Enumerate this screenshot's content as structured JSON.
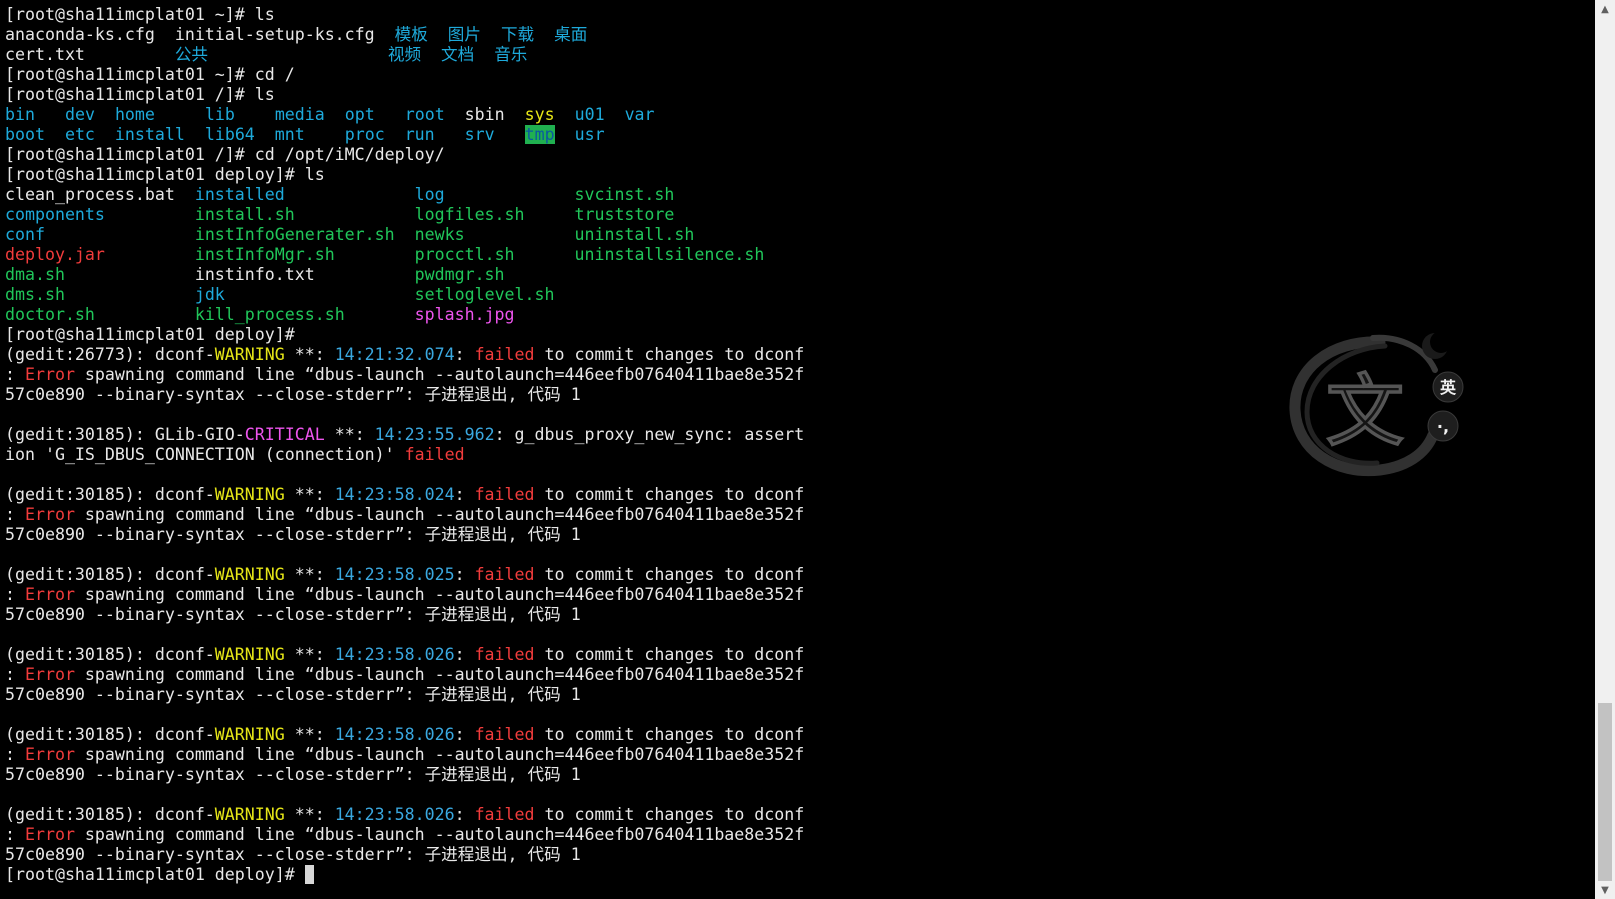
{
  "colors": {
    "background": "#000000",
    "default_text": "#e8e8e8",
    "directory": "#1eaadb",
    "executable": "#20c65a",
    "archive": "#f23c3c",
    "warning": "#e6e617",
    "critical": "#ee55ee",
    "timestamp": "#3aa8e0",
    "tmp_highlight_bg": "#20b050"
  },
  "lines": [
    [
      {
        "t": "[root@sha11imcplat01 ~]# ls",
        "c": "white"
      }
    ],
    [
      {
        "t": "anaconda-ks.cfg  initial-setup-ks.cfg  ",
        "c": "white"
      },
      {
        "t": "模板",
        "c": "blue"
      },
      {
        "t": "  ",
        "c": "white"
      },
      {
        "t": "图片",
        "c": "blue"
      },
      {
        "t": "  ",
        "c": "white"
      },
      {
        "t": "下载",
        "c": "blue"
      },
      {
        "t": "  ",
        "c": "white"
      },
      {
        "t": "桌面",
        "c": "blue"
      }
    ],
    [
      {
        "t": "cert.txt         ",
        "c": "white"
      },
      {
        "t": "公共",
        "c": "blue"
      },
      {
        "t": "                  ",
        "c": "white"
      },
      {
        "t": "视频",
        "c": "blue"
      },
      {
        "t": "  ",
        "c": "white"
      },
      {
        "t": "文档",
        "c": "blue"
      },
      {
        "t": "  ",
        "c": "white"
      },
      {
        "t": "音乐",
        "c": "blue"
      }
    ],
    [
      {
        "t": "[root@sha11imcplat01 ~]# cd /",
        "c": "white"
      }
    ],
    [
      {
        "t": "[root@sha11imcplat01 /]# ls",
        "c": "white"
      }
    ],
    [
      {
        "t": "bin",
        "c": "blue"
      },
      {
        "t": "   ",
        "c": "white"
      },
      {
        "t": "dev",
        "c": "blue"
      },
      {
        "t": "  ",
        "c": "white"
      },
      {
        "t": "home",
        "c": "blue"
      },
      {
        "t": "     ",
        "c": "white"
      },
      {
        "t": "lib",
        "c": "blue"
      },
      {
        "t": "    ",
        "c": "white"
      },
      {
        "t": "media",
        "c": "blue"
      },
      {
        "t": "  ",
        "c": "white"
      },
      {
        "t": "opt",
        "c": "blue"
      },
      {
        "t": "   ",
        "c": "white"
      },
      {
        "t": "root",
        "c": "blue"
      },
      {
        "t": "  ",
        "c": "white"
      },
      {
        "t": "sbin",
        "c": "white"
      },
      {
        "t": "  ",
        "c": "white"
      },
      {
        "t": "sys",
        "c": "yellow"
      },
      {
        "t": "  ",
        "c": "white"
      },
      {
        "t": "u01",
        "c": "blue"
      },
      {
        "t": "  ",
        "c": "white"
      },
      {
        "t": "var",
        "c": "blue"
      }
    ],
    [
      {
        "t": "boot",
        "c": "blue"
      },
      {
        "t": "  ",
        "c": "white"
      },
      {
        "t": "etc",
        "c": "blue"
      },
      {
        "t": "  ",
        "c": "white"
      },
      {
        "t": "install",
        "c": "blue"
      },
      {
        "t": "  ",
        "c": "white"
      },
      {
        "t": "lib64",
        "c": "blue"
      },
      {
        "t": "  ",
        "c": "white"
      },
      {
        "t": "mnt",
        "c": "blue"
      },
      {
        "t": "    ",
        "c": "white"
      },
      {
        "t": "proc",
        "c": "blue"
      },
      {
        "t": "  ",
        "c": "white"
      },
      {
        "t": "run",
        "c": "blue"
      },
      {
        "t": "   ",
        "c": "white"
      },
      {
        "t": "srv",
        "c": "blue"
      },
      {
        "t": "   ",
        "c": "white"
      },
      {
        "t": "tmp",
        "c": "hl"
      },
      {
        "t": "  ",
        "c": "white"
      },
      {
        "t": "usr",
        "c": "blue"
      }
    ],
    [
      {
        "t": "[root@sha11imcplat01 /]# cd /opt/iMC/deploy/",
        "c": "white"
      }
    ],
    [
      {
        "t": "[root@sha11imcplat01 deploy]# ls",
        "c": "white"
      }
    ],
    [
      {
        "t": "clean_process.bat  ",
        "c": "white"
      },
      {
        "t": "installed",
        "c": "blue"
      },
      {
        "t": "             ",
        "c": "white"
      },
      {
        "t": "log",
        "c": "blue"
      },
      {
        "t": "             ",
        "c": "white"
      },
      {
        "t": "svcinst.sh",
        "c": "green"
      }
    ],
    [
      {
        "t": "components",
        "c": "blue"
      },
      {
        "t": "         ",
        "c": "white"
      },
      {
        "t": "install.sh",
        "c": "green"
      },
      {
        "t": "            ",
        "c": "white"
      },
      {
        "t": "logfiles.sh",
        "c": "green"
      },
      {
        "t": "     ",
        "c": "white"
      },
      {
        "t": "truststore",
        "c": "green"
      }
    ],
    [
      {
        "t": "conf",
        "c": "blue"
      },
      {
        "t": "               ",
        "c": "white"
      },
      {
        "t": "instInfoGenerater.sh",
        "c": "green"
      },
      {
        "t": "  ",
        "c": "white"
      },
      {
        "t": "newks",
        "c": "green"
      },
      {
        "t": "           ",
        "c": "white"
      },
      {
        "t": "uninstall.sh",
        "c": "green"
      }
    ],
    [
      {
        "t": "deploy.jar",
        "c": "red"
      },
      {
        "t": "         ",
        "c": "white"
      },
      {
        "t": "instInfoMgr.sh",
        "c": "green"
      },
      {
        "t": "        ",
        "c": "white"
      },
      {
        "t": "procctl.sh",
        "c": "green"
      },
      {
        "t": "      ",
        "c": "white"
      },
      {
        "t": "uninstallsilence.sh",
        "c": "green"
      }
    ],
    [
      {
        "t": "dma.sh",
        "c": "green"
      },
      {
        "t": "             ",
        "c": "white"
      },
      {
        "t": "instinfo.txt",
        "c": "white"
      },
      {
        "t": "          ",
        "c": "white"
      },
      {
        "t": "pwdmgr.sh",
        "c": "green"
      }
    ],
    [
      {
        "t": "dms.sh",
        "c": "green"
      },
      {
        "t": "             ",
        "c": "white"
      },
      {
        "t": "jdk",
        "c": "blue"
      },
      {
        "t": "                   ",
        "c": "white"
      },
      {
        "t": "setloglevel.sh",
        "c": "green"
      }
    ],
    [
      {
        "t": "doctor.sh",
        "c": "green"
      },
      {
        "t": "          ",
        "c": "white"
      },
      {
        "t": "kill_process.sh",
        "c": "green"
      },
      {
        "t": "       ",
        "c": "white"
      },
      {
        "t": "splash.jpg",
        "c": "magenta"
      }
    ],
    [
      {
        "t": "[root@sha11imcplat01 deploy]#",
        "c": "white"
      }
    ],
    [
      {
        "t": "(gedit:26773): dconf-",
        "c": "white"
      },
      {
        "t": "WARNING",
        "c": "yellow"
      },
      {
        "t": " **: ",
        "c": "white"
      },
      {
        "t": "14:21:32.074",
        "c": "cyan"
      },
      {
        "t": ": ",
        "c": "white"
      },
      {
        "t": "failed",
        "c": "red"
      },
      {
        "t": " to commit changes to dconf",
        "c": "white"
      }
    ],
    [
      {
        "t": ": ",
        "c": "white"
      },
      {
        "t": "Error",
        "c": "red"
      },
      {
        "t": " spawning command line “dbus-launch --autolaunch=446eefb07640411bae8e352f",
        "c": "white"
      }
    ],
    [
      {
        "t": "57c0e890 --binary-syntax --close-stderr”: 子进程退出, 代码 1",
        "c": "white"
      }
    ],
    [
      {
        "t": "",
        "c": "white"
      }
    ],
    [
      {
        "t": "(gedit:30185): GLib-GIO-",
        "c": "white"
      },
      {
        "t": "CRITICAL",
        "c": "magenta"
      },
      {
        "t": " **: ",
        "c": "white"
      },
      {
        "t": "14:23:55.962",
        "c": "cyan"
      },
      {
        "t": ": g_dbus_proxy_new_sync: assert",
        "c": "white"
      }
    ],
    [
      {
        "t": "ion 'G_IS_DBUS_CONNECTION (connection)' ",
        "c": "white"
      },
      {
        "t": "failed",
        "c": "red"
      }
    ],
    [
      {
        "t": "",
        "c": "white"
      }
    ],
    [
      {
        "t": "(gedit:30185): dconf-",
        "c": "white"
      },
      {
        "t": "WARNING",
        "c": "yellow"
      },
      {
        "t": " **: ",
        "c": "white"
      },
      {
        "t": "14:23:58.024",
        "c": "cyan"
      },
      {
        "t": ": ",
        "c": "white"
      },
      {
        "t": "failed",
        "c": "red"
      },
      {
        "t": " to commit changes to dconf",
        "c": "white"
      }
    ],
    [
      {
        "t": ": ",
        "c": "white"
      },
      {
        "t": "Error",
        "c": "red"
      },
      {
        "t": " spawning command line “dbus-launch --autolaunch=446eefb07640411bae8e352f",
        "c": "white"
      }
    ],
    [
      {
        "t": "57c0e890 --binary-syntax --close-stderr”: 子进程退出, 代码 1",
        "c": "white"
      }
    ],
    [
      {
        "t": "",
        "c": "white"
      }
    ],
    [
      {
        "t": "(gedit:30185): dconf-",
        "c": "white"
      },
      {
        "t": "WARNING",
        "c": "yellow"
      },
      {
        "t": " **: ",
        "c": "white"
      },
      {
        "t": "14:23:58.025",
        "c": "cyan"
      },
      {
        "t": ": ",
        "c": "white"
      },
      {
        "t": "failed",
        "c": "red"
      },
      {
        "t": " to commit changes to dconf",
        "c": "white"
      }
    ],
    [
      {
        "t": ": ",
        "c": "white"
      },
      {
        "t": "Error",
        "c": "red"
      },
      {
        "t": " spawning command line “dbus-launch --autolaunch=446eefb07640411bae8e352f",
        "c": "white"
      }
    ],
    [
      {
        "t": "57c0e890 --binary-syntax --close-stderr”: 子进程退出, 代码 1",
        "c": "white"
      }
    ],
    [
      {
        "t": "",
        "c": "white"
      }
    ],
    [
      {
        "t": "(gedit:30185): dconf-",
        "c": "white"
      },
      {
        "t": "WARNING",
        "c": "yellow"
      },
      {
        "t": " **: ",
        "c": "white"
      },
      {
        "t": "14:23:58.026",
        "c": "cyan"
      },
      {
        "t": ": ",
        "c": "white"
      },
      {
        "t": "failed",
        "c": "red"
      },
      {
        "t": " to commit changes to dconf",
        "c": "white"
      }
    ],
    [
      {
        "t": ": ",
        "c": "white"
      },
      {
        "t": "Error",
        "c": "red"
      },
      {
        "t": " spawning command line “dbus-launch --autolaunch=446eefb07640411bae8e352f",
        "c": "white"
      }
    ],
    [
      {
        "t": "57c0e890 --binary-syntax --close-stderr”: 子进程退出, 代码 1",
        "c": "white"
      }
    ],
    [
      {
        "t": "",
        "c": "white"
      }
    ],
    [
      {
        "t": "(gedit:30185): dconf-",
        "c": "white"
      },
      {
        "t": "WARNING",
        "c": "yellow"
      },
      {
        "t": " **: ",
        "c": "white"
      },
      {
        "t": "14:23:58.026",
        "c": "cyan"
      },
      {
        "t": ": ",
        "c": "white"
      },
      {
        "t": "failed",
        "c": "red"
      },
      {
        "t": " to commit changes to dconf",
        "c": "white"
      }
    ],
    [
      {
        "t": ": ",
        "c": "white"
      },
      {
        "t": "Error",
        "c": "red"
      },
      {
        "t": " spawning command line “dbus-launch --autolaunch=446eefb07640411bae8e352f",
        "c": "white"
      }
    ],
    [
      {
        "t": "57c0e890 --binary-syntax --close-stderr”: 子进程退出, 代码 1",
        "c": "white"
      }
    ],
    [
      {
        "t": "",
        "c": "white"
      }
    ],
    [
      {
        "t": "(gedit:30185): dconf-",
        "c": "white"
      },
      {
        "t": "WARNING",
        "c": "yellow"
      },
      {
        "t": " **: ",
        "c": "white"
      },
      {
        "t": "14:23:58.026",
        "c": "cyan"
      },
      {
        "t": ": ",
        "c": "white"
      },
      {
        "t": "failed",
        "c": "red"
      },
      {
        "t": " to commit changes to dconf",
        "c": "white"
      }
    ],
    [
      {
        "t": ": ",
        "c": "white"
      },
      {
        "t": "Error",
        "c": "red"
      },
      {
        "t": " spawning command line “dbus-launch --autolaunch=446eefb07640411bae8e352f",
        "c": "white"
      }
    ],
    [
      {
        "t": "57c0e890 --binary-syntax --close-stderr”: 子进程退出, 代码 1",
        "c": "white"
      }
    ]
  ],
  "prompt": {
    "text": "[root@sha11imcplat01 deploy]# "
  },
  "ime": {
    "main_char": "文",
    "mode_label": "英",
    "punct_label": "·,",
    "moon_icon": "moon-icon"
  },
  "scrollbar": {
    "up_glyph": "▲",
    "down_glyph": "▼",
    "position_fraction": 1.0
  }
}
